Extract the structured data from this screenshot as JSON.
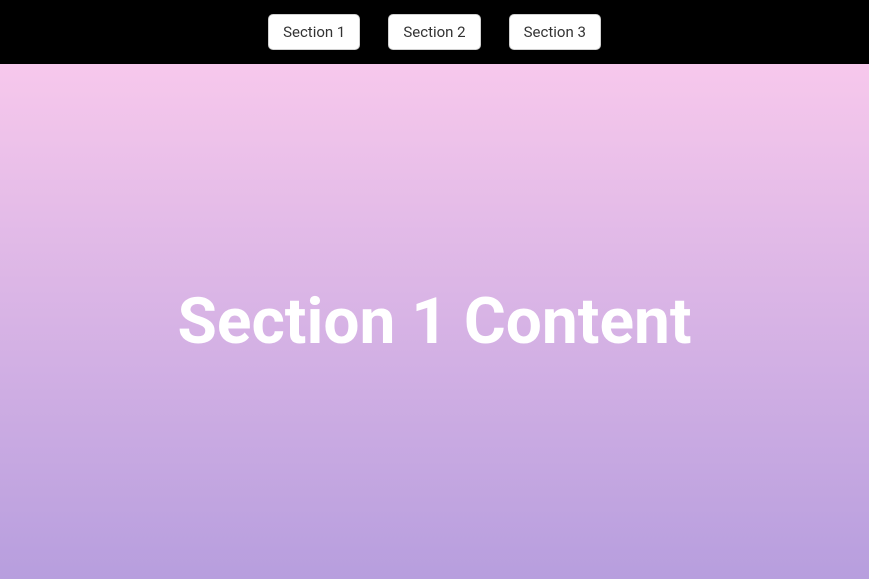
{
  "nav": {
    "buttons": [
      {
        "label": "Section 1"
      },
      {
        "label": "Section 2"
      },
      {
        "label": "Section 3"
      }
    ]
  },
  "content": {
    "heading": "Section 1 Content"
  }
}
